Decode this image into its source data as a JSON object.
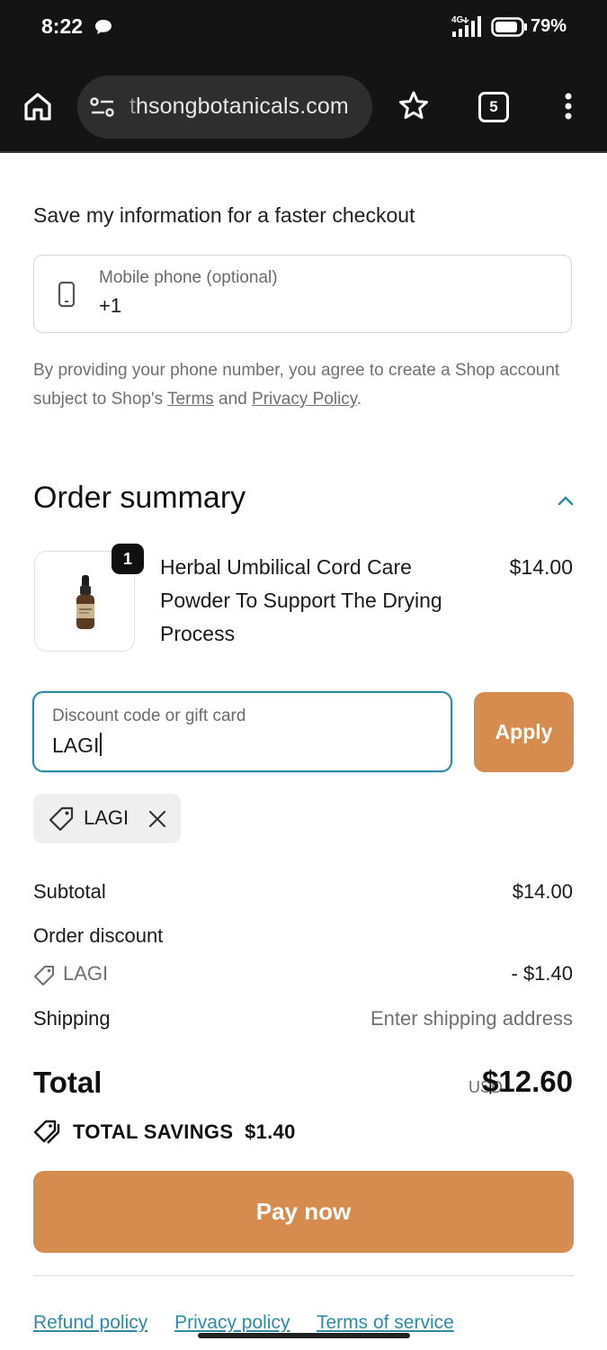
{
  "status_bar": {
    "time": "8:22",
    "network": "4G",
    "battery": "79%"
  },
  "browser": {
    "url_faded": "t",
    "url": "hsongbotanicals.com",
    "tab_count": "5"
  },
  "save_info": {
    "heading": "Save my information for a faster checkout",
    "phone_label": "Mobile phone (optional)",
    "phone_value": "+1",
    "consent_text_1": "By providing your phone number, you agree to create a Shop account subject to Shop's ",
    "terms_link": "Terms",
    "consent_and": " and ",
    "privacy_link": "Privacy Policy",
    "consent_end": "."
  },
  "order_summary": {
    "title": "Order summary",
    "product": {
      "quantity": "1",
      "name": "Herbal Umbilical Cord Care Powder To Support The Drying Process",
      "price": "$14.00"
    },
    "discount": {
      "label": "Discount code or gift card",
      "value": "LAGI",
      "apply_label": "Apply",
      "applied_code": "LAGI"
    },
    "lines": {
      "subtotal_label": "Subtotal",
      "subtotal_value": "$14.00",
      "order_discount_label": "Order discount",
      "discount_code": "LAGI",
      "discount_value": "- $1.40",
      "shipping_label": "Shipping",
      "shipping_value": "Enter shipping address"
    },
    "total": {
      "label": "Total",
      "currency": "USD",
      "value": "$12.60"
    },
    "savings": "TOTAL SAVINGS  $1.40"
  },
  "pay_button": "Pay now",
  "footer_links": [
    "Refund policy",
    "Privacy policy",
    "Terms of service"
  ],
  "colors": {
    "accent_button": "#d68c4f",
    "focus_border": "#2f8aa6",
    "browser_chrome": "#141414"
  }
}
